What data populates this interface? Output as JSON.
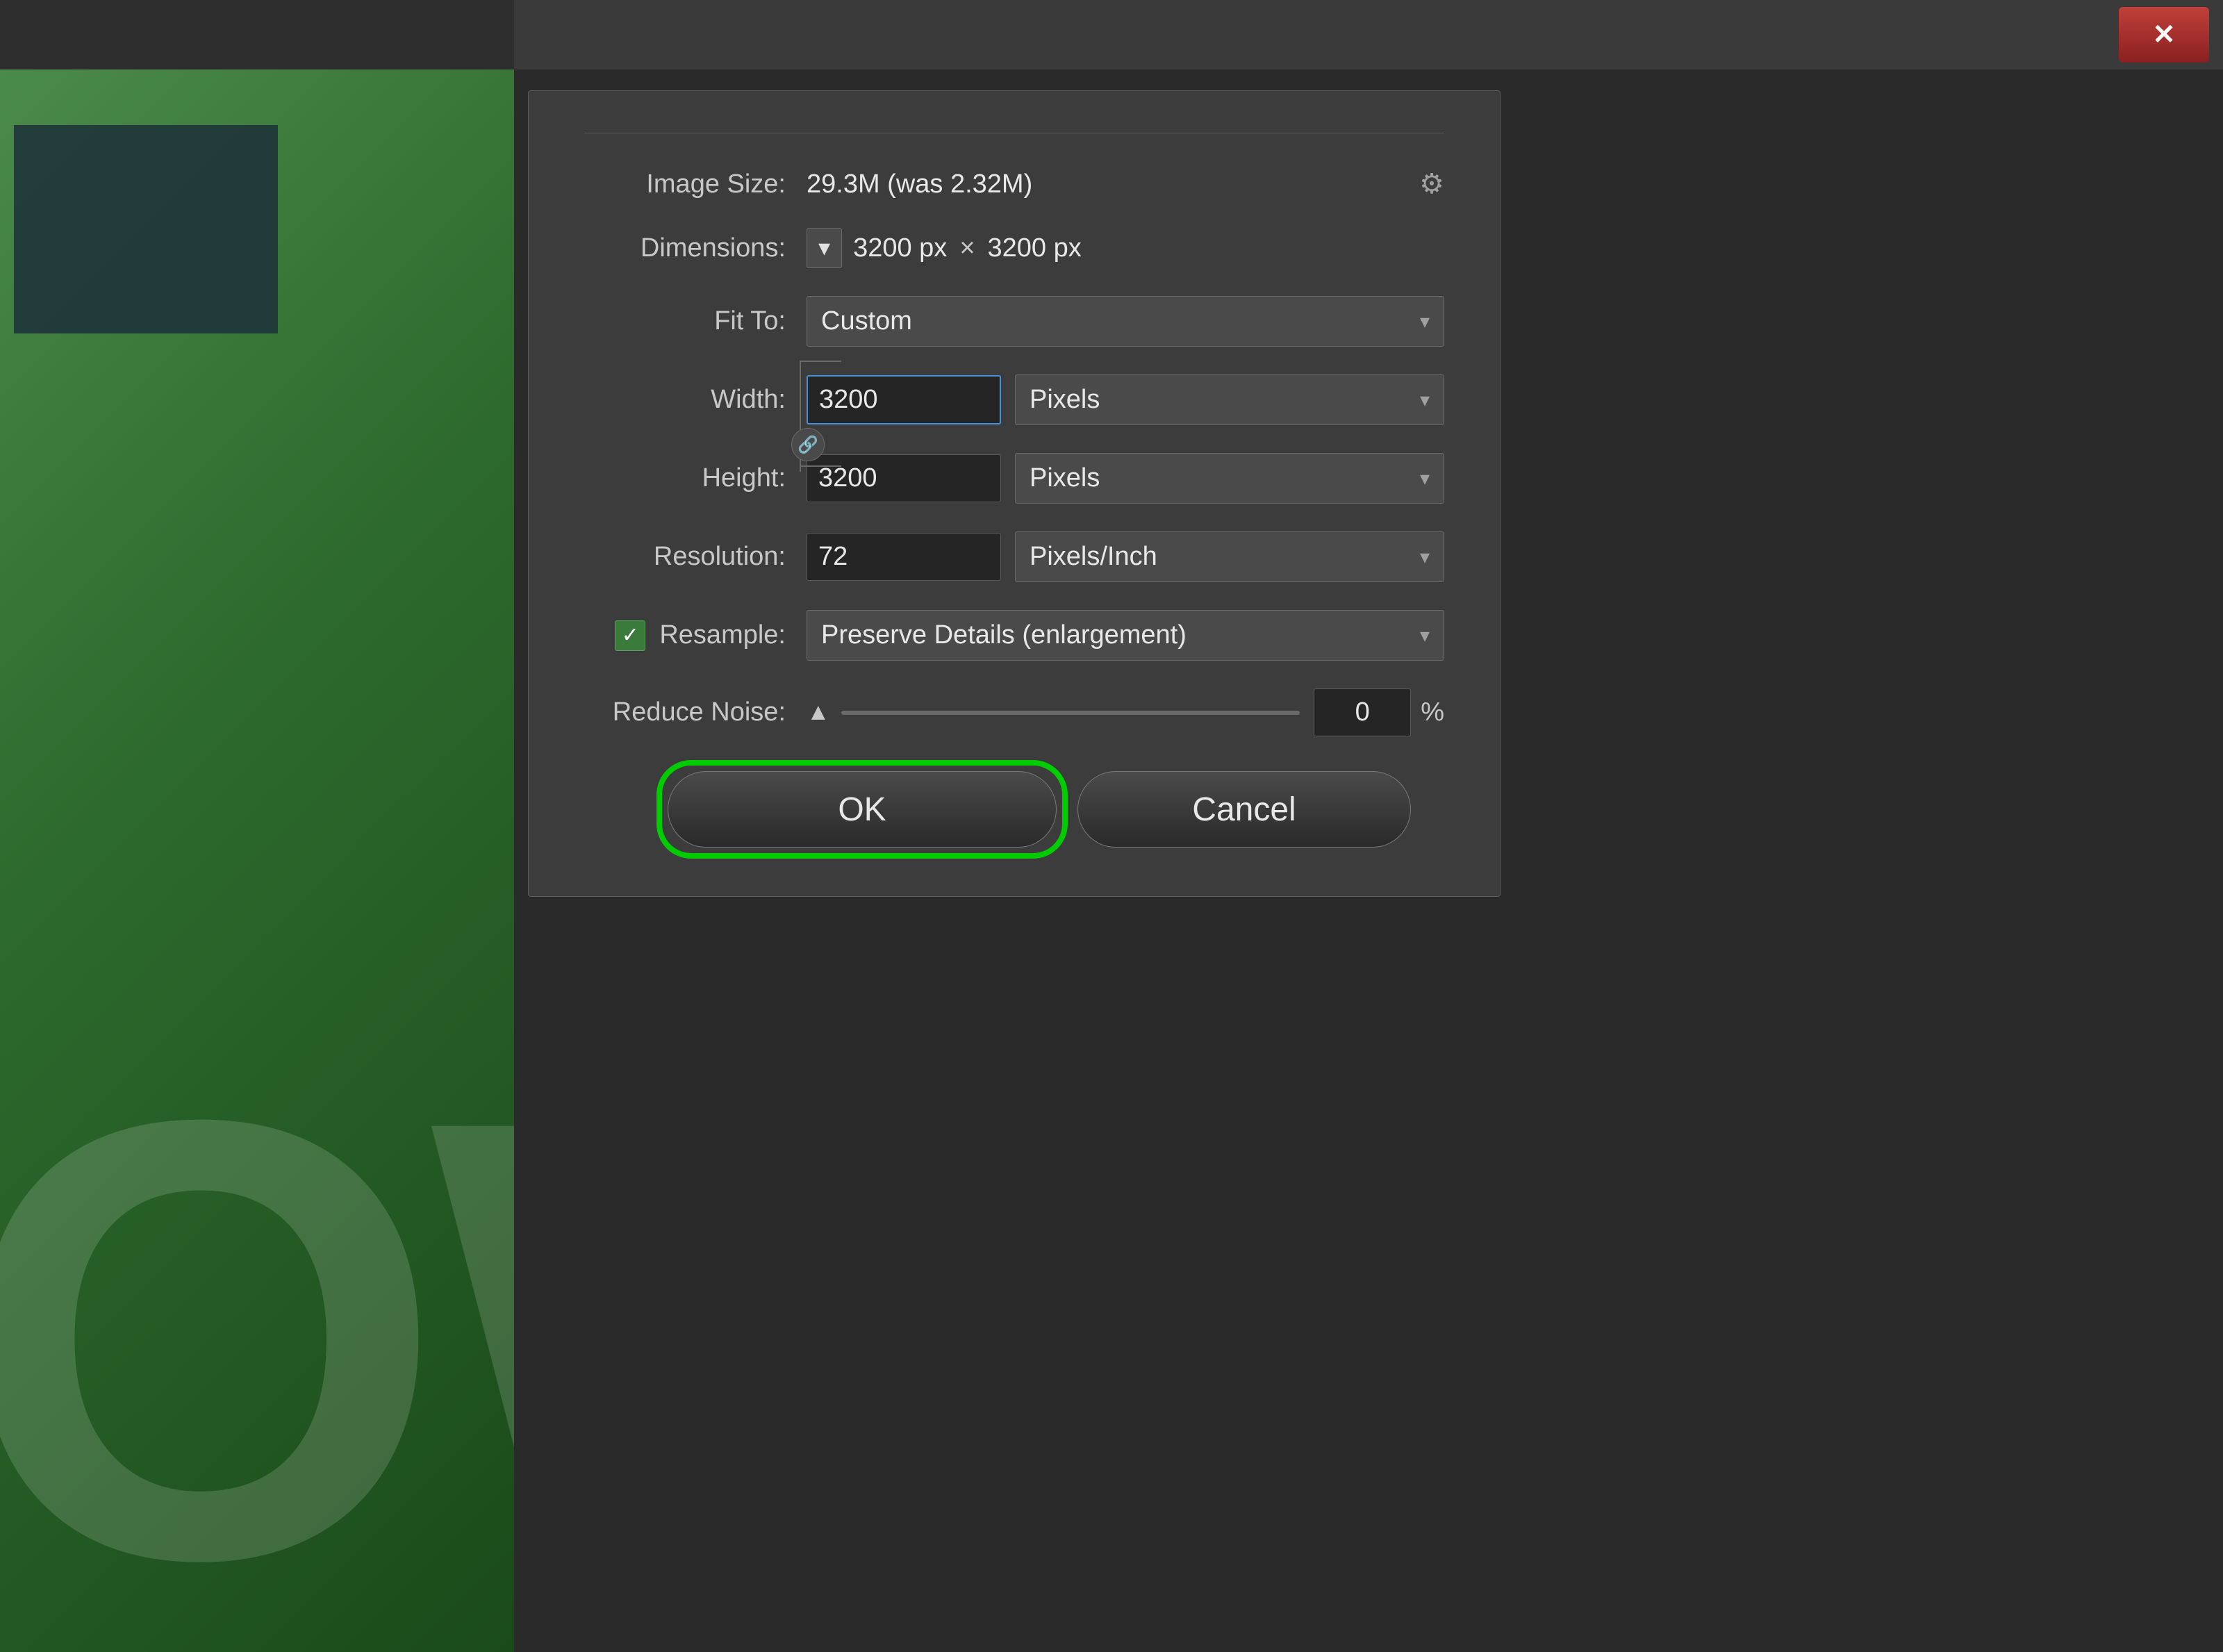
{
  "background": {
    "color": "#2d2d2d"
  },
  "titlebar": {
    "close_button_label": "✕"
  },
  "dialog": {
    "image_size_label": "Image Size:",
    "image_size_value": "29.3M (was 2.32M)",
    "dimensions_label": "Dimensions:",
    "dimensions_width": "3200 px",
    "dimensions_times": "×",
    "dimensions_height": "3200 px",
    "fit_to_label": "Fit To:",
    "fit_to_value": "Custom",
    "width_label": "Width:",
    "width_value": "3200",
    "width_unit": "Pixels",
    "height_label": "Height:",
    "height_value": "3200",
    "height_unit": "Pixels",
    "resolution_label": "Resolution:",
    "resolution_value": "72",
    "resolution_unit": "Pixels/Inch",
    "resample_label": "Resample:",
    "resample_value": "Preserve Details (enlargement)",
    "reduce_noise_label": "Reduce Noise:",
    "reduce_noise_value": "0",
    "reduce_noise_percent": "%",
    "ok_label": "OK",
    "cancel_label": "Cancel"
  }
}
